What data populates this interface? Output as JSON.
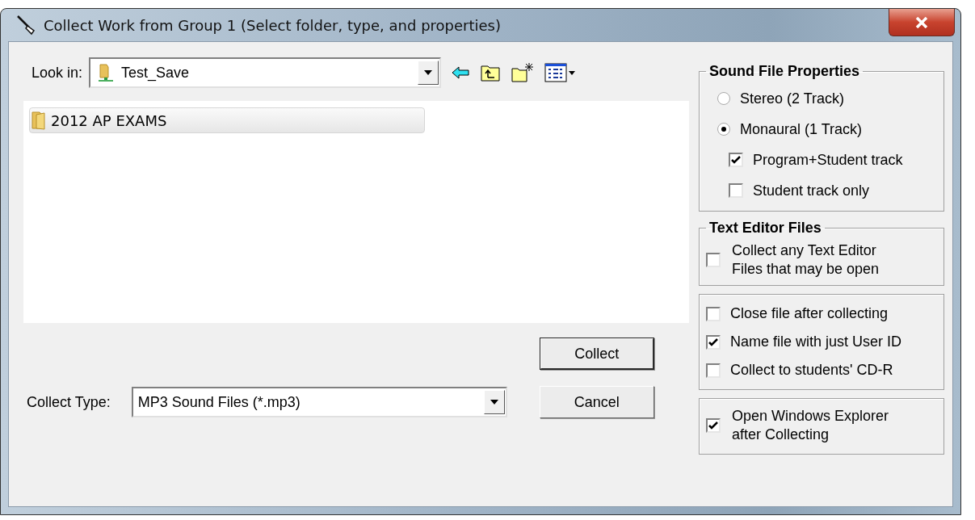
{
  "window": {
    "title": "Collect Work from Group 1 (Select folder, type, and properties)"
  },
  "look_in": {
    "label": "Look in:",
    "value": "Test_Save"
  },
  "files": [
    {
      "name": "2012 AP EXAMS",
      "selected": true
    }
  ],
  "collect_type": {
    "label": "Collect Type:",
    "value": "MP3 Sound Files (*.mp3)"
  },
  "buttons": [
    {
      "label": "Collect",
      "default": true
    },
    {
      "label": "Cancel",
      "default": false
    }
  ],
  "sound_properties": {
    "title": "Sound File Properties",
    "modes": [
      {
        "label": "Stereo (2 Track)",
        "selected": false
      },
      {
        "label": "Monaural (1 Track)",
        "selected": true
      }
    ],
    "tracks": [
      {
        "label": "Program+Student track",
        "checked": true
      },
      {
        "label": "Student track only",
        "checked": false
      }
    ]
  },
  "text_editor": {
    "title": "Text Editor Files",
    "label": "Collect any Text Editor Files that may be open",
    "checked": false
  },
  "options": [
    {
      "label": "Close file after collecting",
      "checked": false
    },
    {
      "label": "Name file with just User ID",
      "checked": true
    },
    {
      "label": "Collect to students' CD-R",
      "checked": false
    }
  ],
  "explorer": {
    "label": "Open Windows Explorer after Collecting",
    "checked": true
  }
}
